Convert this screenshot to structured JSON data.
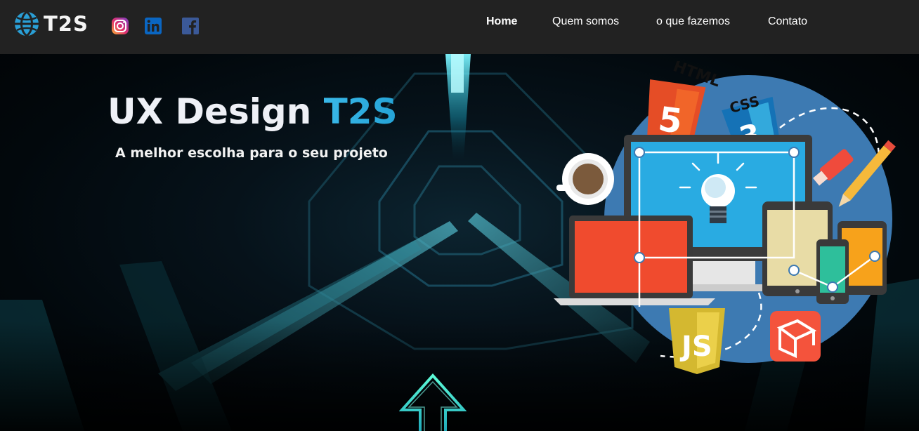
{
  "brand": {
    "name": "T2S",
    "logo_icon": "globe-icon"
  },
  "social": [
    {
      "name": "instagram",
      "icon": "instagram-icon",
      "color": "#e1306c"
    },
    {
      "name": "linkedin",
      "icon": "linkedin-icon",
      "color": "#0a66c2"
    },
    {
      "name": "facebook",
      "icon": "facebook-icon",
      "color": "#3b5998"
    }
  ],
  "nav": {
    "items": [
      {
        "label": "Home",
        "active": true
      },
      {
        "label": "Quem somos",
        "active": false
      },
      {
        "label": "o que fazemos",
        "active": false
      },
      {
        "label": "Contato",
        "active": false
      }
    ]
  },
  "hero": {
    "title_main": "UX Design ",
    "title_accent": "T2S",
    "subtitle": "A melhor escolha para o seu projeto",
    "illustration_labels": {
      "html": "HTML",
      "css": "CSS",
      "js": "JS"
    }
  },
  "colors": {
    "navbar_bg": "#222222",
    "accent": "#2aa7da",
    "hero_bg": "#02080c",
    "illustration_circle": "#3d7ab2"
  },
  "scroll_icon": "arrow-up-icon"
}
